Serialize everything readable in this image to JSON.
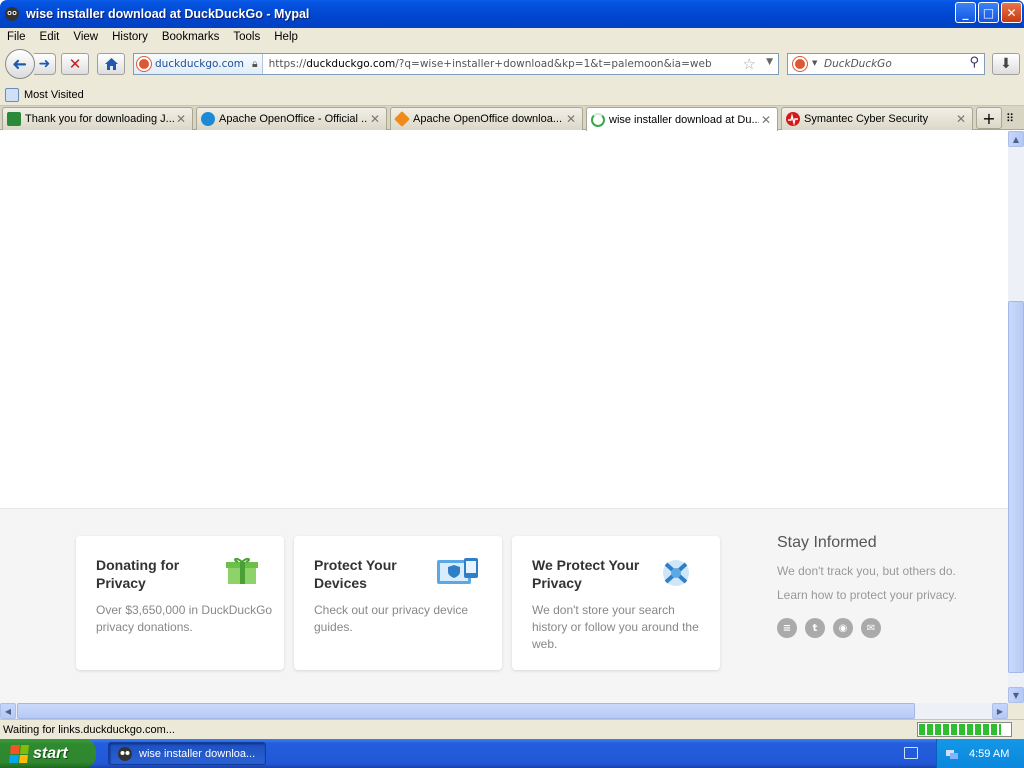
{
  "window": {
    "title": "wise installer download at DuckDuckGo - Mypal",
    "minimize": "_",
    "maximize": "□",
    "close": "✕"
  },
  "menu": [
    "File",
    "Edit",
    "View",
    "History",
    "Bookmarks",
    "Tools",
    "Help"
  ],
  "nav": {
    "identity_label": "duckduckgo.com",
    "url_prefix": "https://",
    "url_host": "duckduckgo.com",
    "url_rest": "/?q=wise+installer+download&kp=1&t=palemoon&ia=web",
    "search_placeholder": "DuckDuckGo"
  },
  "bookmarks": {
    "most_visited": "Most Visited"
  },
  "tabs": [
    {
      "label": "Thank you for downloading J...",
      "color": "#2a8a3a"
    },
    {
      "label": "Apache OpenOffice - Official ...",
      "color": "#1e8ad6"
    },
    {
      "label": "Apache OpenOffice downloa...",
      "color": "#f08a1c"
    },
    {
      "label": "wise installer download at Du...",
      "color": "#3aa84a"
    },
    {
      "label": "Symantec Cyber Security",
      "color": "#d21a1a"
    }
  ],
  "footer": {
    "cards": [
      {
        "title": "Donating for Privacy",
        "body": "Over $3,650,000 in DuckDuckGo privacy donations."
      },
      {
        "title": "Protect Your Devices",
        "body": "Check out our privacy device guides."
      },
      {
        "title": "We Protect Your Privacy",
        "body": "We don't store your search history or follow you around the web."
      }
    ],
    "stay_title": "Stay Informed",
    "stay_line1": "We don't track you, but others do.",
    "stay_line2": "Learn how to protect your privacy."
  },
  "status": {
    "text": "Waiting for links.duckduckgo.com...",
    "progress_fraction": 0.9
  },
  "taskbar": {
    "start_label": "start",
    "task_label": "wise installer downloa...",
    "clock": "4:59 AM"
  },
  "colors": {
    "ddg_orange": "#de5833",
    "xp_blue": "#0045cf"
  }
}
